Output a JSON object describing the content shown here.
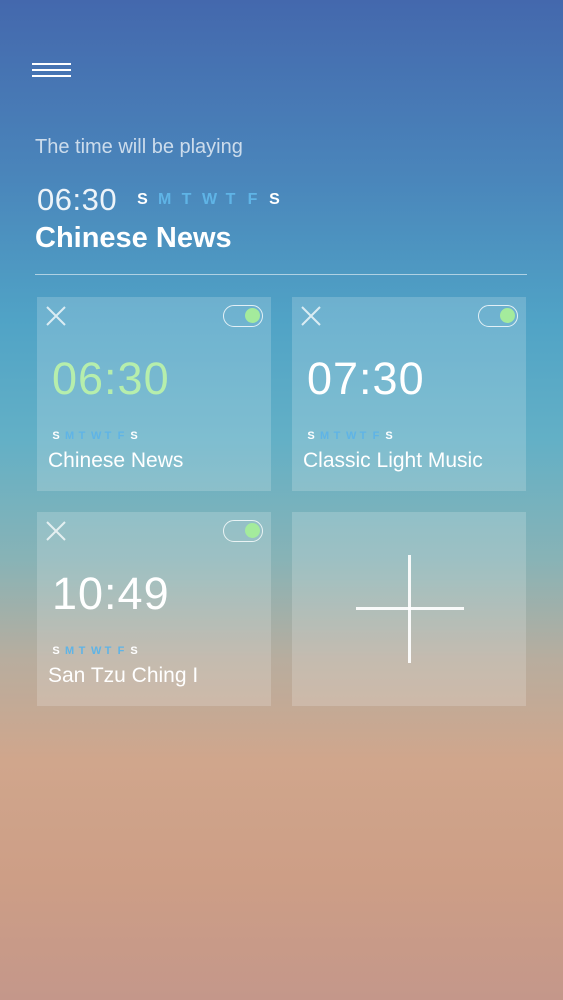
{
  "header": {
    "menu_icon": "hamburger-menu-icon",
    "subtitle": "The time will be playing",
    "time": "06:30",
    "days": [
      {
        "letter": "S",
        "active": true
      },
      {
        "letter": "M",
        "active": false
      },
      {
        "letter": "T",
        "active": false
      },
      {
        "letter": "W",
        "active": false
      },
      {
        "letter": "T",
        "active": false
      },
      {
        "letter": "F",
        "active": false
      },
      {
        "letter": "S",
        "active": true
      }
    ],
    "title": "Chinese News"
  },
  "alarms": [
    {
      "time": "06:30",
      "name": "Chinese News",
      "enabled": true,
      "highlight": true,
      "days": [
        {
          "letter": "S",
          "active": true
        },
        {
          "letter": "M",
          "active": false
        },
        {
          "letter": "T",
          "active": false
        },
        {
          "letter": "W",
          "active": false
        },
        {
          "letter": "T",
          "active": false
        },
        {
          "letter": "F",
          "active": false
        },
        {
          "letter": "S",
          "active": true
        }
      ]
    },
    {
      "time": "07:30",
      "name": "Classic Light Music",
      "enabled": true,
      "highlight": false,
      "days": [
        {
          "letter": "S",
          "active": true
        },
        {
          "letter": "M",
          "active": false
        },
        {
          "letter": "T",
          "active": false
        },
        {
          "letter": "W",
          "active": false
        },
        {
          "letter": "T",
          "active": false
        },
        {
          "letter": "F",
          "active": false
        },
        {
          "letter": "S",
          "active": true
        }
      ]
    },
    {
      "time": "10:49",
      "name": "San Tzu Ching I",
      "enabled": true,
      "highlight": false,
      "days": [
        {
          "letter": "S",
          "active": true
        },
        {
          "letter": "M",
          "active": false
        },
        {
          "letter": "T",
          "active": false
        },
        {
          "letter": "W",
          "active": false
        },
        {
          "letter": "T",
          "active": false
        },
        {
          "letter": "F",
          "active": false
        },
        {
          "letter": "S",
          "active": true
        }
      ]
    }
  ],
  "add_card": {
    "icon": "plus-icon"
  },
  "colors": {
    "day_active": "#ffffff",
    "day_inactive": "#5fb4e6",
    "toggle_knob": "#a4eb9c",
    "highlight_time": "#b6eeac"
  }
}
